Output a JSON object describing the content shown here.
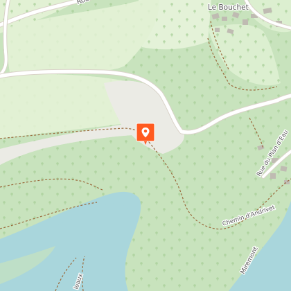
{
  "map": {
    "place_labels": {
      "le_bouchet": "Le Bouchet"
    },
    "road_labels": {
      "route": "Rou",
      "rue_plan_eau": "Rue du Plan d'Eau",
      "chemin_andrivet": "Chemin d'Andrivet",
      "miremont": "Miremont",
      "rue_bottom": "leaux"
    },
    "marker": {
      "kind": "point-of-interest",
      "icon": "location-pin-icon",
      "color": "#ff5a1f"
    },
    "colors": {
      "forest": "#c8e3bd",
      "forest_light": "#d8ecd0",
      "meadow": "#e2f1d4",
      "clearing": "#ebebe5",
      "water": "#a9d6dc",
      "road": "#ffffff",
      "road_casing": "#d9d2c8",
      "trail": "#9a6a3c",
      "building": "#bfbbb2"
    }
  }
}
